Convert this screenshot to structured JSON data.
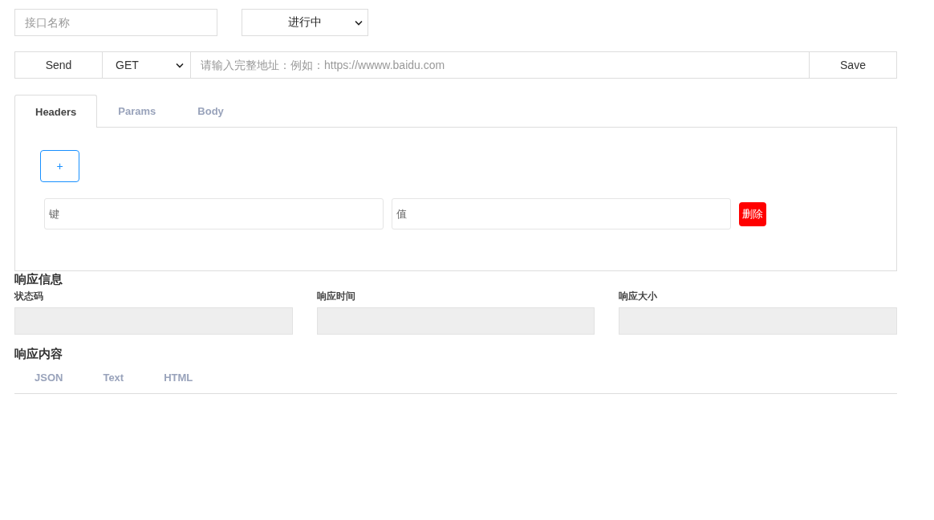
{
  "name_field": {
    "placeholder": "接口名称"
  },
  "status_select": {
    "value": "进行中"
  },
  "request_bar": {
    "send_button": "Send",
    "method": "GET",
    "url_field": {
      "placeholder": "请输入完整地址：例如：https://wwww.baidu.com"
    },
    "save_button": "Save"
  },
  "request_tabs": [
    {
      "label": "Headers",
      "selected": true
    },
    {
      "label": "Params",
      "selected": false
    },
    {
      "label": "Body",
      "selected": false
    }
  ],
  "headers_panel": {
    "add_button": "+",
    "rows": [
      {
        "key": {
          "placeholder": "键"
        },
        "value": {
          "placeholder": "值"
        },
        "delete_button": "删除"
      }
    ]
  },
  "response_info": {
    "title": "响应信息",
    "fields": [
      {
        "label": "状态码"
      },
      {
        "label": "响应时间"
      },
      {
        "label": "响应大小"
      }
    ]
  },
  "response_content": {
    "title": "响应内容",
    "tabs": [
      {
        "label": "JSON",
        "selected": false
      },
      {
        "label": "Text",
        "selected": false
      },
      {
        "label": "HTML",
        "selected": false
      }
    ]
  }
}
